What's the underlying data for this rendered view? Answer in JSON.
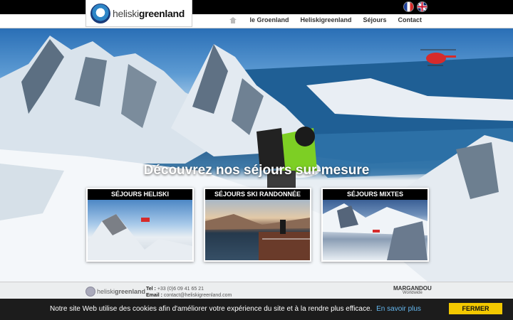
{
  "header": {
    "logo_text_light": "heliski",
    "logo_text_bold": "greenland",
    "languages": [
      "fr",
      "en"
    ]
  },
  "nav": {
    "items": [
      {
        "label": "le Groenland"
      },
      {
        "label": "Heliskigreenland"
      },
      {
        "label": "Séjours"
      },
      {
        "label": "Contact"
      }
    ]
  },
  "hero": {
    "title": "Découvrez nos séjours sur-mesure",
    "cards": [
      {
        "label": "SÉJOURS HELISKI"
      },
      {
        "label": "SÉJOURS SKI RANDONNÉE"
      },
      {
        "label": "SÉJOURS MIXTES"
      }
    ]
  },
  "footer": {
    "logo_text_light": "heliski",
    "logo_text_bold": "greenland",
    "tel_label": "Tel :",
    "tel_value": "+33 (0)6 09 41 65 21",
    "email_label": "Email :",
    "email_value": "contact@heliskigreenland.com",
    "partner_name": "MARGANDOU",
    "partner_sub": "Worldwide"
  },
  "cookie": {
    "text": "Notre site Web utilise des cookies afin d'améliorer votre expérience du site et à la rendre plus efficace.",
    "link": "En savoir plus",
    "button": "FERMER"
  },
  "colors": {
    "cookie_button": "#f2c800",
    "cookie_link": "#65b8f0",
    "topbar": "#000000"
  }
}
